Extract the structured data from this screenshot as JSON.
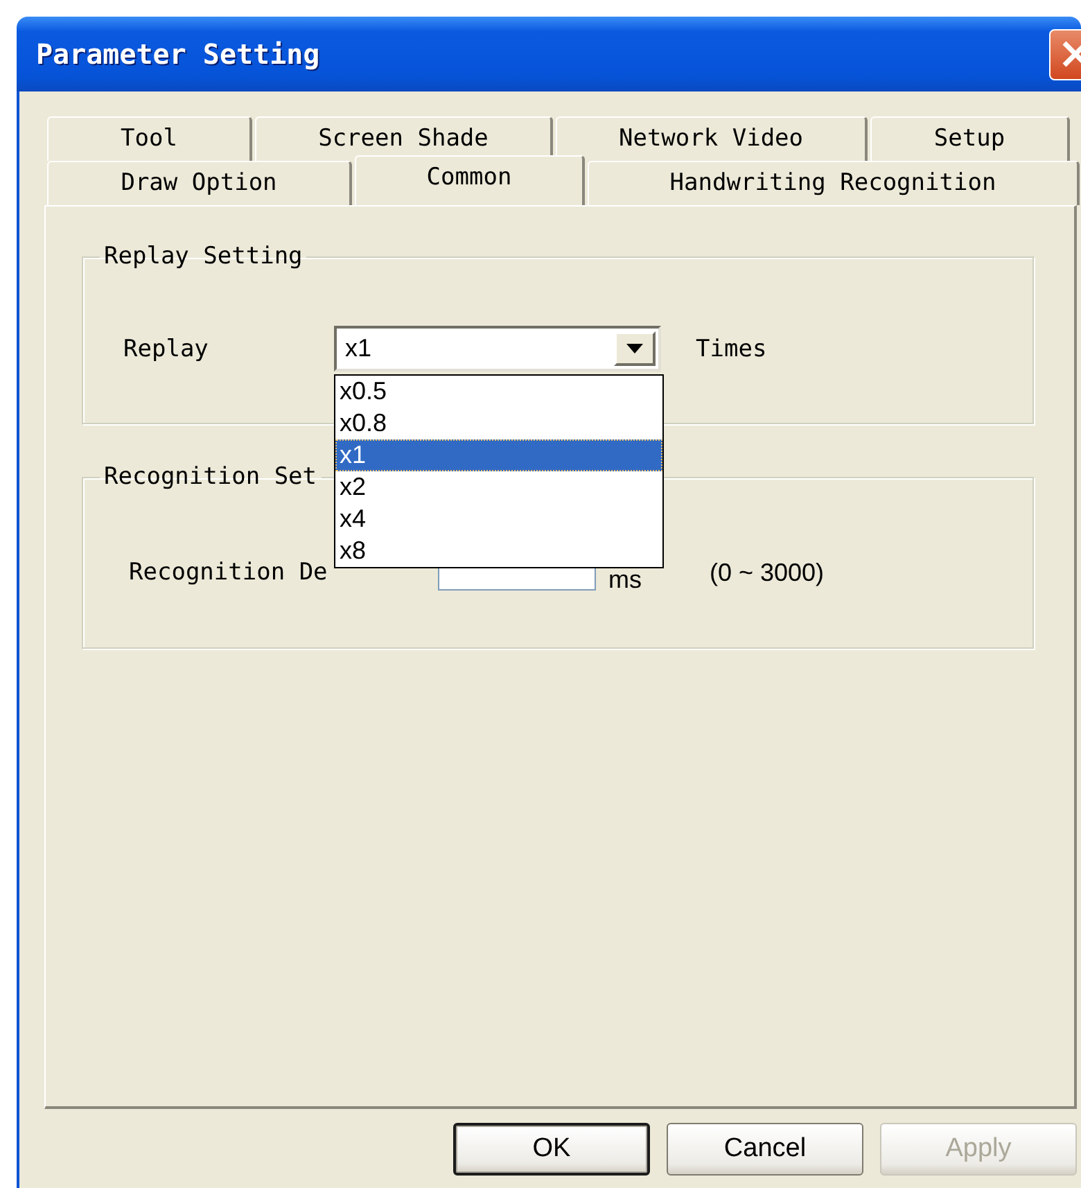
{
  "window": {
    "title": "Parameter Setting"
  },
  "tab_rows": [
    [
      {
        "label": "Tool",
        "selected": false
      },
      {
        "label": "Screen Shade",
        "selected": false
      },
      {
        "label": "Network Video",
        "selected": false
      },
      {
        "label": "Setup",
        "selected": false
      }
    ],
    [
      {
        "label": "Draw Option",
        "selected": false
      },
      {
        "label": "Common",
        "selected": true
      },
      {
        "label": "Handwriting Recognition",
        "selected": false
      }
    ]
  ],
  "replay_setting": {
    "title": "Replay Setting",
    "label": "Replay",
    "combo": {
      "value": "x1",
      "expanded": true,
      "options": [
        {
          "label": "x0.5",
          "selected": false
        },
        {
          "label": "x0.8",
          "selected": false
        },
        {
          "label": "x1",
          "selected": true
        },
        {
          "label": "x2",
          "selected": false
        },
        {
          "label": "x4",
          "selected": false
        },
        {
          "label": "x8",
          "selected": false
        }
      ]
    },
    "unit": "Times"
  },
  "recognition_setting": {
    "title": "Recognition Set",
    "label": "Recognition De",
    "unit": "ms",
    "range": "(0 ~ 3000)"
  },
  "buttons": [
    {
      "label": "OK",
      "default": true,
      "disabled": false
    },
    {
      "label": "Cancel",
      "default": false,
      "disabled": false
    },
    {
      "label": "Apply",
      "default": false,
      "disabled": true
    }
  ]
}
